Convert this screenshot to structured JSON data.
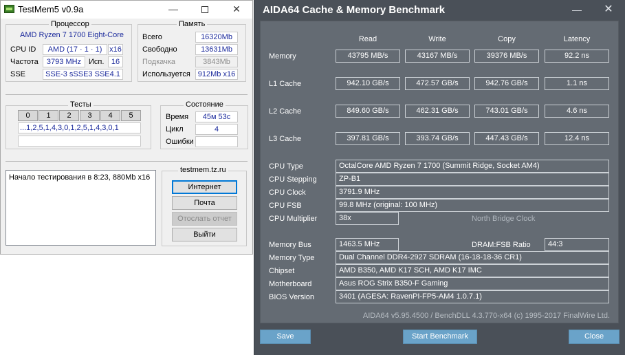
{
  "testmem": {
    "title": "TestMem5 v0.9a",
    "window_controls": {
      "minimize": "—",
      "close": "✕"
    },
    "cpu_group": {
      "title": "Процессор",
      "model": "AMD Ryzen 7 1700 Eight-Core",
      "cpuid_label": "CPU ID",
      "cpuid_value": "AMD  (17 · 1 · 1)",
      "threads": "x16",
      "freq_label": "Частота",
      "freq_value": "3793 MHz",
      "used_label": "Исп.",
      "used_value": "16",
      "sse_label": "SSE",
      "sse_value": "SSE-3 sSSE3 SSE4.1"
    },
    "mem_group": {
      "title": "Память",
      "total_label": "Всего",
      "total_value": "16320Mb",
      "free_label": "Свободно",
      "free_value": "13631Mb",
      "swap_label": "Подкачка",
      "swap_value": "3843Mb",
      "inuse_label": "Используется",
      "inuse_value": "912Mb x16"
    },
    "tests_group": {
      "title": "Тесты",
      "tabs": [
        "0",
        "1",
        "2",
        "3",
        "4",
        "5"
      ],
      "sequence": "...1,2,5,1,4,3,0,1,2,5,1,4,3,0,1"
    },
    "state_group": {
      "title": "Состояние",
      "time_label": "Время",
      "time_value": "45м 53с",
      "cycle_label": "Цикл",
      "cycle_value": "4",
      "errors_label": "Ошибки",
      "errors_value": ""
    },
    "log_text": "Начало тестирования в 8:23, 880Mb x16",
    "site_group": {
      "title": "testmem.tz.ru",
      "internet_button": "Интернет",
      "mail_button": "Почта",
      "report_button": "Отослать отчет",
      "exit_button": "Выйти"
    }
  },
  "aida": {
    "title": "AIDA64 Cache & Memory Benchmark",
    "window_controls": {
      "minimize": "—",
      "close": "✕"
    },
    "columns": [
      "Read",
      "Write",
      "Copy",
      "Latency"
    ],
    "rows": [
      {
        "label": "Memory",
        "values": [
          "43795 MB/s",
          "43167 MB/s",
          "39376 MB/s",
          "92.2 ns"
        ]
      },
      {
        "label": "L1 Cache",
        "values": [
          "942.10 GB/s",
          "472.57 GB/s",
          "942.76 GB/s",
          "1.1 ns"
        ]
      },
      {
        "label": "L2 Cache",
        "values": [
          "849.60 GB/s",
          "462.31 GB/s",
          "743.01 GB/s",
          "4.6 ns"
        ]
      },
      {
        "label": "L3 Cache",
        "values": [
          "397.81 GB/s",
          "393.74 GB/s",
          "447.43 GB/s",
          "12.4 ns"
        ]
      }
    ],
    "info": {
      "cpu_type_label": "CPU Type",
      "cpu_type": "OctalCore AMD Ryzen 7 1700  (Summit Ridge, Socket AM4)",
      "cpu_stepping_label": "CPU Stepping",
      "cpu_stepping": "ZP-B1",
      "cpu_clock_label": "CPU Clock",
      "cpu_clock": "3791.9 MHz",
      "cpu_fsb_label": "CPU FSB",
      "cpu_fsb": "99.8 MHz  (original: 100 MHz)",
      "cpu_multiplier_label": "CPU Multiplier",
      "cpu_multiplier": "38x",
      "north_bridge_clock_label": "North Bridge Clock",
      "memory_bus_label": "Memory Bus",
      "memory_bus": "1463.5 MHz",
      "dram_fsb_label": "DRAM:FSB Ratio",
      "dram_fsb": "44:3",
      "memory_type_label": "Memory Type",
      "memory_type": "Dual Channel DDR4-2927 SDRAM  (16-18-18-36 CR1)",
      "chipset_label": "Chipset",
      "chipset": "AMD B350, AMD K17 SCH, AMD K17 IMC",
      "motherboard_label": "Motherboard",
      "motherboard": "Asus ROG Strix B350-F Gaming",
      "bios_label": "BIOS Version",
      "bios": "3401  (AGESA: RavenPI-FP5-AM4 1.0.7.1)"
    },
    "footer": "AIDA64 v5.95.4500 / BenchDLL 4.3.770-x64  (c) 1995-2017 FinalWire Ltd.",
    "buttons": {
      "save": "Save",
      "start": "Start Benchmark",
      "close": "Close"
    }
  }
}
